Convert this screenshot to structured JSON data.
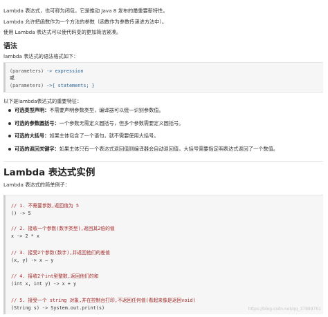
{
  "intro": {
    "line1": "Lambda 表达式，也可称为闭包，它是推动 Java 8 发布的最重要新特性。",
    "line2": "Lambda 允许把函数作为一个方法的参数（函数作为参数传递进方法中）。",
    "line3": "使用 Lambda 表达式可以使代码变的更加简洁紧凑。"
  },
  "syntax": {
    "heading": "语法",
    "desc": "lambda 表达式的语法格式如下：",
    "code": {
      "line1_params": "(parameters)",
      "line1_arrow": " -> ",
      "line1_body": "expression",
      "line2": "或",
      "line3_params": "(parameters)",
      "line3_rest": " ->{ statements; }"
    }
  },
  "features": {
    "desc": "以下是lambda表达式的重要特征：",
    "items": [
      {
        "term": "可选类型声明：",
        "text": "不需要声明参数类型，编译器可以统一识别参数值。"
      },
      {
        "term": "可选的参数圆括号：",
        "text": "一个参数无需定义圆括号，但多个参数需要定义圆括号。"
      },
      {
        "term": "可选的大括号：",
        "text": "如果主体包含了一个语句，就不需要使用大括号。"
      },
      {
        "term": "可选的返回关键字：",
        "text": "如果主体只有一个表达式返回值则编译器会自动返回值，大括号需要指定明表达式返回了一个数值。"
      }
    ]
  },
  "examples": {
    "heading": "Lambda 表达式实例",
    "desc": "Lambda 表达式的简单例子：",
    "items": [
      {
        "comment": "// 1. 不需要参数,返回值为 5",
        "code": "() -> 5"
      },
      {
        "comment": "// 2. 接收一个参数(数字类型),返回其2倍的值",
        "code": "x -> 2 * x"
      },
      {
        "comment": "// 3. 接受2个参数(数字),并返回他们的差值",
        "code": "(x, y) -> x – y"
      },
      {
        "comment": "// 4. 接收2个int型整数,返回他们的和",
        "code": "(int x, int y) -> x + y"
      },
      {
        "comment": "// 5. 接受一个 string 对象,并在控制台打印,不返回任何值(看起来像是返回void)",
        "code": "(String s) -> System.out.print(s)"
      }
    ]
  },
  "watermark": "https://blog.csdn.net/qq_37889761"
}
